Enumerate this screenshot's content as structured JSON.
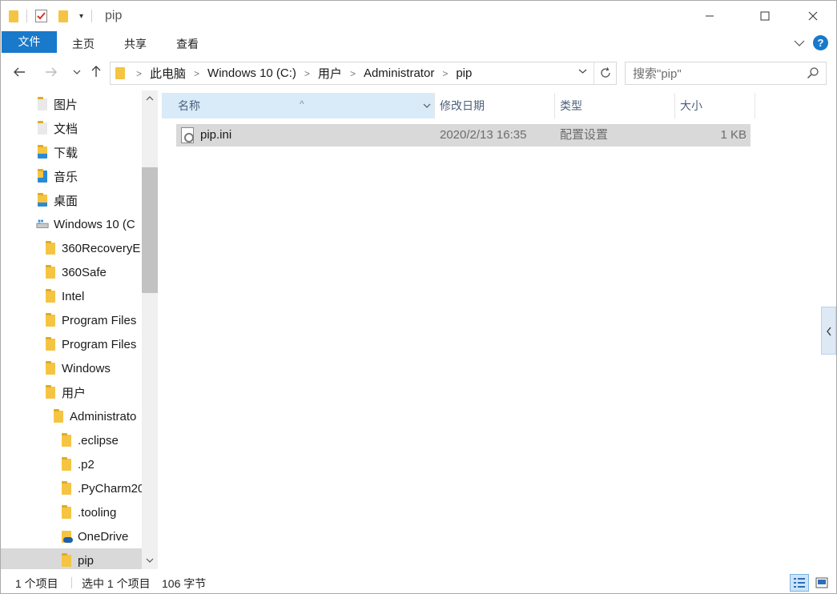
{
  "window": {
    "title": "pip"
  },
  "ribbon": {
    "tabs": [
      "文件",
      "主页",
      "共享",
      "查看"
    ]
  },
  "address": {
    "crumbs": [
      "此电脑",
      "Windows 10 (C:)",
      "用户",
      "Administrator",
      "pip"
    ]
  },
  "search": {
    "placeholder": "搜索\"pip\""
  },
  "nav_tree": [
    {
      "label": "图片",
      "icon": "pictures-icon",
      "indent": 0
    },
    {
      "label": "文档",
      "icon": "documents-icon",
      "indent": 0
    },
    {
      "label": "下载",
      "icon": "downloads-icon",
      "indent": 0
    },
    {
      "label": "音乐",
      "icon": "music-icon",
      "indent": 0
    },
    {
      "label": "桌面",
      "icon": "desktop-icon",
      "indent": 0
    },
    {
      "label": "Windows 10 (C",
      "icon": "drive-icon",
      "indent": 0
    },
    {
      "label": "360RecoveryE",
      "icon": "folder-icon",
      "indent": 1
    },
    {
      "label": "360Safe",
      "icon": "folder-icon",
      "indent": 1
    },
    {
      "label": "Intel",
      "icon": "folder-icon",
      "indent": 1
    },
    {
      "label": "Program Files",
      "icon": "folder-icon",
      "indent": 1
    },
    {
      "label": "Program Files",
      "icon": "folder-icon",
      "indent": 1
    },
    {
      "label": "Windows",
      "icon": "folder-icon",
      "indent": 1
    },
    {
      "label": "用户",
      "icon": "folder-icon",
      "indent": 1
    },
    {
      "label": "Administrato",
      "icon": "folder-icon",
      "indent": 2
    },
    {
      "label": ".eclipse",
      "icon": "folder-icon",
      "indent": 3
    },
    {
      "label": ".p2",
      "icon": "folder-icon",
      "indent": 3
    },
    {
      "label": ".PyCharm20",
      "icon": "folder-icon",
      "indent": 3
    },
    {
      "label": ".tooling",
      "icon": "folder-icon",
      "indent": 3
    },
    {
      "label": "OneDrive",
      "icon": "onedrive-icon",
      "indent": 3
    },
    {
      "label": "pip",
      "icon": "folder-icon",
      "indent": 3,
      "selected": true
    }
  ],
  "columns": {
    "name": "名称",
    "modified": "修改日期",
    "type": "类型",
    "size": "大小"
  },
  "files": [
    {
      "name": "pip.ini",
      "modified": "2020/2/13 16:35",
      "type": "配置设置",
      "size": "1 KB"
    }
  ],
  "status": {
    "count": "1 个项目",
    "selected": "选中 1 个项目",
    "size": "106 字节"
  }
}
